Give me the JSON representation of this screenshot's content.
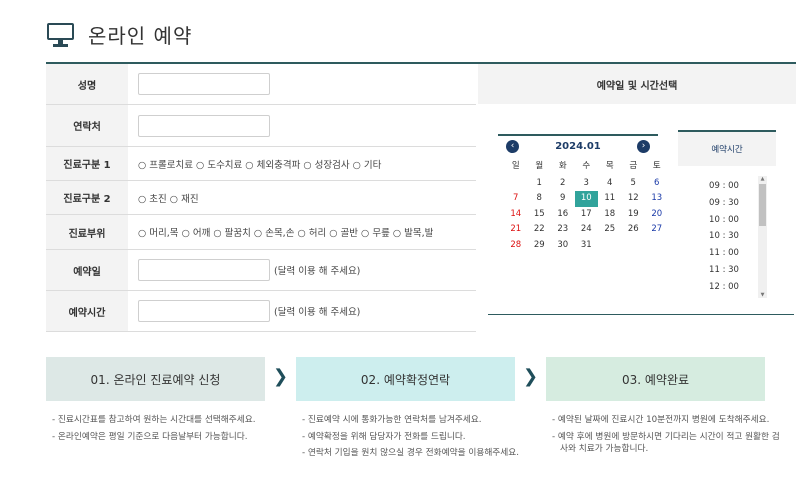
{
  "header": {
    "title": "온라인 예약",
    "icon": "monitor-icon"
  },
  "form": {
    "name_label": "성명",
    "contact_label": "연락처",
    "type1_label": "진료구분 1",
    "type1_options": [
      "프롤로치료",
      "도수치료",
      "체외충격파",
      "성장검사",
      "기타"
    ],
    "type2_label": "진료구분 2",
    "type2_options": [
      "초진",
      "재진"
    ],
    "part_label": "진료부위",
    "part_options": [
      "머리,목",
      "어깨",
      "팔꿈치",
      "손목,손",
      "허리",
      "골반",
      "무릎",
      "발목,발"
    ],
    "date_label": "예약일",
    "date_hint": "(달력 이용 해 주세요)",
    "time_label": "예약시간",
    "time_hint": "(달력 이용 해 주세요)"
  },
  "calendar_panel": {
    "title": "예약일 및 시간선택",
    "month_title": "2024.01",
    "weekdays": [
      "일",
      "월",
      "화",
      "수",
      "목",
      "금",
      "토"
    ],
    "first_weekday": 1,
    "days_in_month": 31,
    "today": 10,
    "time_title": "예약시간",
    "times": [
      "09 : 00",
      "09 : 30",
      "10 : 00",
      "10 : 30",
      "11 : 00",
      "11 : 30",
      "12 : 00"
    ]
  },
  "steps": [
    {
      "label": "01. 온라인 진료예약 신청",
      "notes": [
        "- 진료시간표를 참고하여 원하는 시간대를 선택해주세요.",
        "- 온라인예약은 평일 기준으로 다음날부터 가능합니다."
      ]
    },
    {
      "label": "02. 예약확정연락",
      "notes": [
        "- 진료예약 시에 통화가능한 연락처를 남겨주세요.",
        "- 예약확정을 위해 담당자가 전화를 드립니다.",
        "- 연락처 기입을 원치 않으실 경우 전화예약을 이용해주세요."
      ]
    },
    {
      "label": "03. 예약완료",
      "notes": [
        "- 예약된 날짜에 진료시간 10분전까지 병원에 도착해주세요.",
        "- 예약 후에 병원에 방문하시면 기다리는 시간이 적고 원활한 검사와 치료가 가능합니다."
      ]
    }
  ],
  "colors": {
    "accent_dark": "#2e5b5e",
    "today": "#31a39b",
    "nav": "#1d3c67"
  }
}
